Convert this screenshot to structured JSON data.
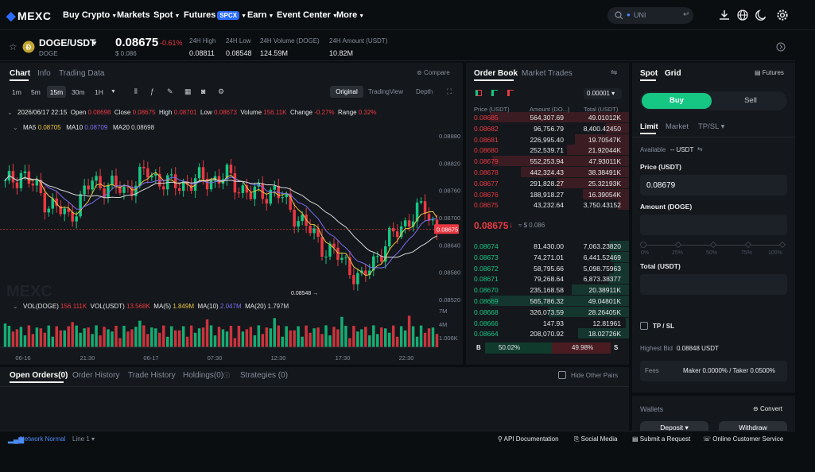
{
  "nav": {
    "logo": "MEXC",
    "items": [
      "Buy Crypto",
      "Markets",
      "Spot",
      "Futures",
      "Earn",
      "Event Center",
      "More"
    ],
    "futures_badge": "SPCX",
    "search_placeholder": "UNI"
  },
  "ticker": {
    "pair": "DOGE/USDT",
    "coin": "DOGE",
    "price": "0.08675",
    "change": "-0.61%",
    "price_usd": "$ 0.086",
    "stats": [
      {
        "label": "24H High",
        "value": "0.08811"
      },
      {
        "label": "24H Low",
        "value": "0.08548"
      },
      {
        "label": "24H Volume (DOGE)",
        "value": "124.59M"
      },
      {
        "label": "24H Amount (USDT)",
        "value": "10.82M"
      }
    ]
  },
  "chart": {
    "tabs": [
      "Chart",
      "Info",
      "Trading Data"
    ],
    "compare": "Compare",
    "intervals": [
      "1m",
      "5m",
      "15m",
      "30m",
      "1H"
    ],
    "views": [
      "Original",
      "TradingView",
      "Depth"
    ],
    "ohlc": {
      "date": "2026/06/17 22:15",
      "open_label": "Open",
      "open": "0.08698",
      "close_label": "Close",
      "close": "0.08675",
      "high_label": "High",
      "high": "0.08701",
      "low_label": "Low",
      "low": "0.08673",
      "vol_label": "Volume",
      "vol": "156.11K",
      "chg_label": "Change",
      "chg": "-0.27%",
      "rng_label": "Range",
      "rng": "0.32%"
    },
    "ma": {
      "ma5_label": "MA5",
      "ma5": "0.08705",
      "ma10_label": "MA10",
      "ma10": "0.08709",
      "ma20_label": "MA20",
      "ma20": "0.08698"
    },
    "vol_legend": {
      "v1_label": "VOL(DOGE)",
      "v1": "156.111K",
      "v2_label": "VOL(USDT)",
      "v2": "13.568K",
      "m5_label": "MA(5)",
      "m5": "1.849M",
      "m10_label": "MA(10)",
      "m10": "2.047M",
      "m20_label": "MA(20)",
      "m20": "1.797M"
    },
    "y_ticks": [
      "0.08880",
      "0.08820",
      "0.08760",
      "0.08700",
      "0.08640",
      "0.08580",
      "0.08520"
    ],
    "current_price_tag": "0.08675",
    "low_marker": "0.08548",
    "vol_ticks": [
      "7M",
      "4M",
      "1.006K"
    ],
    "x_ticks": [
      "06-16",
      "21:30",
      "06-17",
      "07:30",
      "12:30",
      "17:30",
      "22:30"
    ],
    "watermark": "MEXC",
    "colors": {
      "up": "#16c784",
      "down": "#ea3943",
      "ma5": "#e8c547",
      "ma10": "#7b6ff2",
      "ma20": "#d6d6d6"
    }
  },
  "orderbook": {
    "tabs": [
      "Order Book",
      "Market Trades"
    ],
    "precision": "0.00001",
    "headers": [
      "Price (USDT)",
      "Amount (DO...)",
      "Total (USDT)"
    ],
    "asks": [
      {
        "price": "0.08685",
        "amount": "564,307.69",
        "total": "49.01012K",
        "depth": 0.9
      },
      {
        "price": "0.08682",
        "amount": "96,756.79",
        "total": "8,400.42450",
        "depth": 0.15
      },
      {
        "price": "0.08681",
        "amount": "226,995.40",
        "total": "19.70547K",
        "depth": 0.35
      },
      {
        "price": "0.08680",
        "amount": "252,539.71",
        "total": "21.92044K",
        "depth": 0.4
      },
      {
        "price": "0.08679",
        "amount": "552,253.94",
        "total": "47.93011K",
        "depth": 0.88
      },
      {
        "price": "0.08678",
        "amount": "442,324.43",
        "total": "38.38491K",
        "depth": 0.7
      },
      {
        "price": "0.08677",
        "amount": "291,828.27",
        "total": "25.32193K",
        "depth": 0.46
      },
      {
        "price": "0.08676",
        "amount": "188,918.27",
        "total": "16.39054K",
        "depth": 0.3
      },
      {
        "price": "0.08675",
        "amount": "43,232.64",
        "total": "3,750.43152",
        "depth": 0.07
      }
    ],
    "last_price": "0.08675",
    "last_usd": "≈ $ 0.086",
    "bids": [
      {
        "price": "0.08674",
        "amount": "81,430.00",
        "total": "7,063.23820",
        "depth": 0.13
      },
      {
        "price": "0.08673",
        "amount": "74,271.01",
        "total": "6,441.52469",
        "depth": 0.12
      },
      {
        "price": "0.08672",
        "amount": "58,795.66",
        "total": "5,098.75963",
        "depth": 0.1
      },
      {
        "price": "0.08671",
        "amount": "79,268.64",
        "total": "6,873.38377",
        "depth": 0.13
      },
      {
        "price": "0.08670",
        "amount": "235,168.58",
        "total": "20.38911K",
        "depth": 0.37
      },
      {
        "price": "0.08669",
        "amount": "565,786.32",
        "total": "49.04801K",
        "depth": 0.9
      },
      {
        "price": "0.08668",
        "amount": "326,073.59",
        "total": "28.26405K",
        "depth": 0.52
      },
      {
        "price": "0.08666",
        "amount": "147.93",
        "total": "12.81961",
        "depth": 0.02
      },
      {
        "price": "0.08664",
        "amount": "208,070.92",
        "total": "18.02726K",
        "depth": 0.33
      }
    ],
    "buy_label": "B",
    "buy_pct": "50.02%",
    "sell_pct": "49.98%",
    "sell_label": "S"
  },
  "trade": {
    "tabs": [
      "Spot",
      "Grid"
    ],
    "futures": "Futures",
    "buy": "Buy",
    "sell": "Sell",
    "order_types": [
      "Limit",
      "Market",
      "TP/SL"
    ],
    "available_label": "Available",
    "available_value": "-- USDT",
    "price_label": "Price (USDT)",
    "price_value": "0.08679",
    "amount_label": "Amount (DOGE)",
    "slider_marks": [
      "0%",
      "25%",
      "50%",
      "75%",
      "100%"
    ],
    "total_label": "Total (USDT)",
    "tpsl_label": "TP / SL",
    "highest_bid_label": "Highest Bid",
    "highest_bid_value": "0.08848 USDT",
    "fees_label": "Fees",
    "fees_value": "Maker 0.0000% / Taker 0.0500%"
  },
  "wallet": {
    "title": "Wallets",
    "convert": "Convert",
    "deposit": "Deposit",
    "withdraw": "Withdraw"
  },
  "orders": {
    "tabs": [
      "Open Orders(0)",
      "Order History",
      "Trade History",
      "Holdings(0)",
      "Strategies (0)"
    ],
    "hide_other": "Hide Other Pairs"
  },
  "footer": {
    "network": "Network Normal",
    "line": "Line 1",
    "links": [
      "API Documentation",
      "Social Media",
      "Submit a Request",
      "Online Customer Service"
    ]
  }
}
